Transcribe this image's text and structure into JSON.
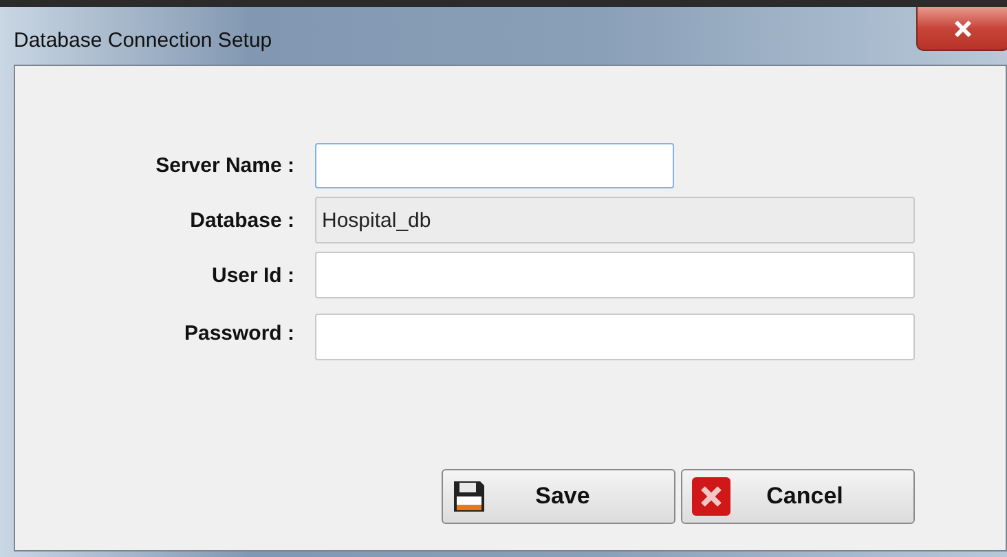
{
  "window": {
    "title": "Database Connection Setup"
  },
  "fields": [
    {
      "label": "Server Name :",
      "focused": true,
      "readonly": false,
      "wide": false
    },
    {
      "label": "Database :",
      "value": "Hospital_db",
      "focused": false,
      "readonly": true,
      "wide": true
    },
    {
      "label": "User Id :",
      "focused": false,
      "readonly": false,
      "wide": true
    },
    {
      "label": "Password :",
      "focused": false,
      "readonly": false,
      "wide": true
    }
  ],
  "buttons": [
    {
      "label": "Save",
      "kind": "save"
    },
    {
      "label": "Cancel",
      "kind": "cancel"
    }
  ]
}
